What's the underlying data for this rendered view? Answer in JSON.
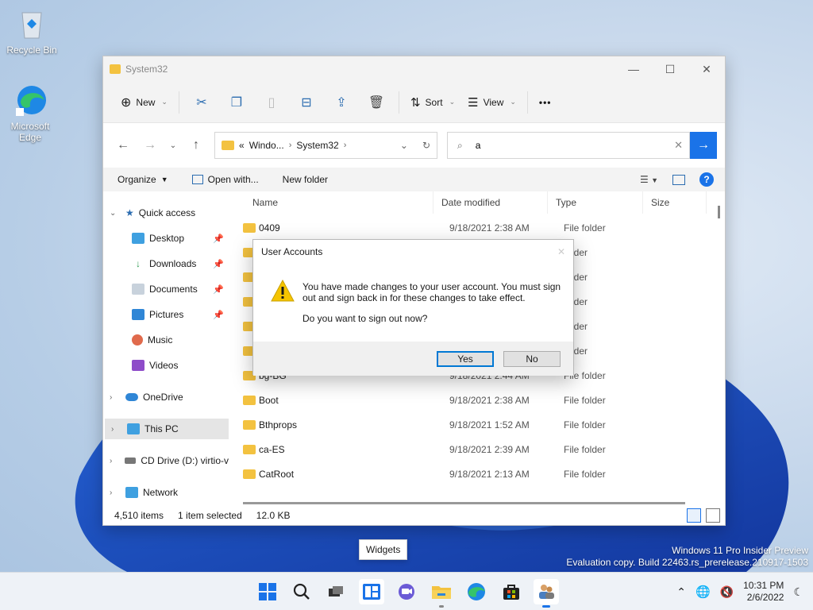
{
  "desktop": {
    "recycle_bin": "Recycle Bin",
    "edge_line1": "Microsoft",
    "edge_line2": "Edge"
  },
  "explorer": {
    "title": "System32",
    "toolbar": {
      "new": "New",
      "sort": "Sort",
      "view": "View",
      "more": "•••"
    },
    "address": {
      "prefix": "«",
      "crumb1": "Windo...",
      "crumb2": "System32"
    },
    "search": {
      "value": "a"
    },
    "commands": {
      "organize": "Organize",
      "open_with": "Open with...",
      "new_folder": "New folder"
    },
    "nav": [
      {
        "label": "Quick access"
      },
      {
        "label": "Desktop"
      },
      {
        "label": "Downloads"
      },
      {
        "label": "Documents"
      },
      {
        "label": "Pictures"
      },
      {
        "label": "Music"
      },
      {
        "label": "Videos"
      },
      {
        "label": "OneDrive"
      },
      {
        "label": "This PC"
      },
      {
        "label": "CD Drive (D:) virtio-v"
      },
      {
        "label": "Network"
      }
    ],
    "columns": {
      "name": "Name",
      "date": "Date modified",
      "type": "Type",
      "size": "Size"
    },
    "rows": [
      {
        "name": "0409",
        "date": "9/18/2021 2:38 AM",
        "type": "File folder"
      },
      {
        "name": "",
        "date": "",
        "type": "folder"
      },
      {
        "name": "",
        "date": "",
        "type": "folder"
      },
      {
        "name": "",
        "date": "",
        "type": "folder"
      },
      {
        "name": "",
        "date": "",
        "type": "folder"
      },
      {
        "name": "",
        "date": "",
        "type": "folder"
      },
      {
        "name": "bg-BG",
        "date": "9/18/2021 2:44 AM",
        "type": "File folder"
      },
      {
        "name": "Boot",
        "date": "9/18/2021 2:38 AM",
        "type": "File folder"
      },
      {
        "name": "Bthprops",
        "date": "9/18/2021 1:52 AM",
        "type": "File folder"
      },
      {
        "name": "ca-ES",
        "date": "9/18/2021 2:39 AM",
        "type": "File folder"
      },
      {
        "name": "CatRoot",
        "date": "9/18/2021 2:13 AM",
        "type": "File folder"
      }
    ],
    "status": {
      "items": "4,510 items",
      "selected": "1 item selected",
      "size": "12.0 KB"
    }
  },
  "dialog": {
    "title": "User Accounts",
    "message": "You have made changes to your user account. You must sign out and sign back in for these changes to take effect.",
    "question": "Do you want to sign out now?",
    "yes": "Yes",
    "no": "No"
  },
  "tooltip": "Widgets",
  "watermark": {
    "line1": "Windows 11 Pro Insider Preview",
    "line2": "Evaluation copy. Build 22463.rs_prerelease.210917-1503"
  },
  "clock": {
    "time": "10:31 PM",
    "date": "2/6/2022"
  },
  "colors": {
    "accent": "#1a73e8",
    "folder": "#f3c240",
    "warning": "#f5c400"
  }
}
